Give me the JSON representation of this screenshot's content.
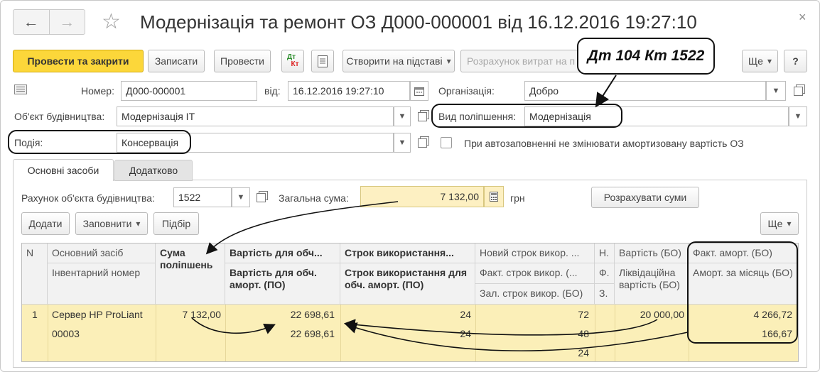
{
  "window": {
    "title": "Модернізація та ремонт ОЗ Д000-000001 від 16.12.2016 19:27:10",
    "nav_back": "←",
    "nav_forward": "→",
    "close": "×"
  },
  "toolbar": {
    "post_close": "Провести та закрити",
    "save": "Записати",
    "post": "Провести",
    "dtkt_dt": "Дт",
    "dtkt_kt": "Кт",
    "create_based": "Створити на підставі",
    "cost_calc": "Розрахунок витрат на п",
    "more": "Ще",
    "help": "?"
  },
  "annotation": {
    "callout": "Дт 104  Кт 1522"
  },
  "header": {
    "number_label": "Номер:",
    "number_value": "Д000-000001",
    "date_label": "від:",
    "date_value": "16.12.2016 19:27:10",
    "org_label": "Організація:",
    "org_value": "Добро",
    "object_label": "Об'єкт будівництва:",
    "object_value": "Модернізація IT",
    "improvement_label": "Вид поліпшення:",
    "improvement_value": "Модернізація",
    "event_label": "Подія:",
    "event_value": "Консервація",
    "autofill_label": "При автозаповненні не змінювати амортизовану вартість ОЗ"
  },
  "tabs": [
    {
      "label": "Основні засоби"
    },
    {
      "label": "Додатково"
    }
  ],
  "panel": {
    "account_label": "Рахунок об'єкта будівництва:",
    "account_value": "1522",
    "total_label": "Загальна сума:",
    "total_value": "7 132,00",
    "currency": "грн",
    "calc_button": "Розрахувати суми",
    "add_button": "Додати",
    "fill_button": "Заповнити",
    "select_button": "Підбір",
    "more_button": "Ще"
  },
  "table": {
    "headers": {
      "n": "N",
      "asset": "Основний засіб",
      "inventory": "Інвентарний номер",
      "sum": "Сума поліпшень",
      "cost_tax": "Вартість для обч...",
      "cost_tax_po": "Вартість для обч. аморт. (ПО)",
      "term": "Строк використання...",
      "term_po": "Строк використання для обч. аморт. (ПО)",
      "new_term": "Новий строк викор. ...",
      "fact_term": "Факт. строк викор. (...",
      "rem_term": "Зал. строк викор. (БО)",
      "h1": "Н.",
      "h2": "Ф.",
      "h3": "З.",
      "cost_bo": "Вартість (БО)",
      "liq": "Ліквідаційна вартість (БО)",
      "fact_amort": "Факт. аморт. (БО)",
      "amort_month": "Аморт. за місяць (БО)"
    },
    "rows": [
      {
        "n": "1",
        "asset": "Сервер HP ProLiant",
        "inventory": "00003",
        "sum": "7 132,00",
        "cost_tax": "22 698,61",
        "cost_tax_po": "22 698,61",
        "term": "24",
        "term_po": "24",
        "new_term": "72",
        "fact_term": "48",
        "rem_term": "24",
        "cost_bo": "20 000,00",
        "fact_amort": "4 266,72",
        "amort_month": "166,67"
      }
    ]
  },
  "colors": {
    "primary_button": "#fcd73a",
    "row_highlight": "#fbefb8",
    "total_field": "#fdf0c2"
  }
}
